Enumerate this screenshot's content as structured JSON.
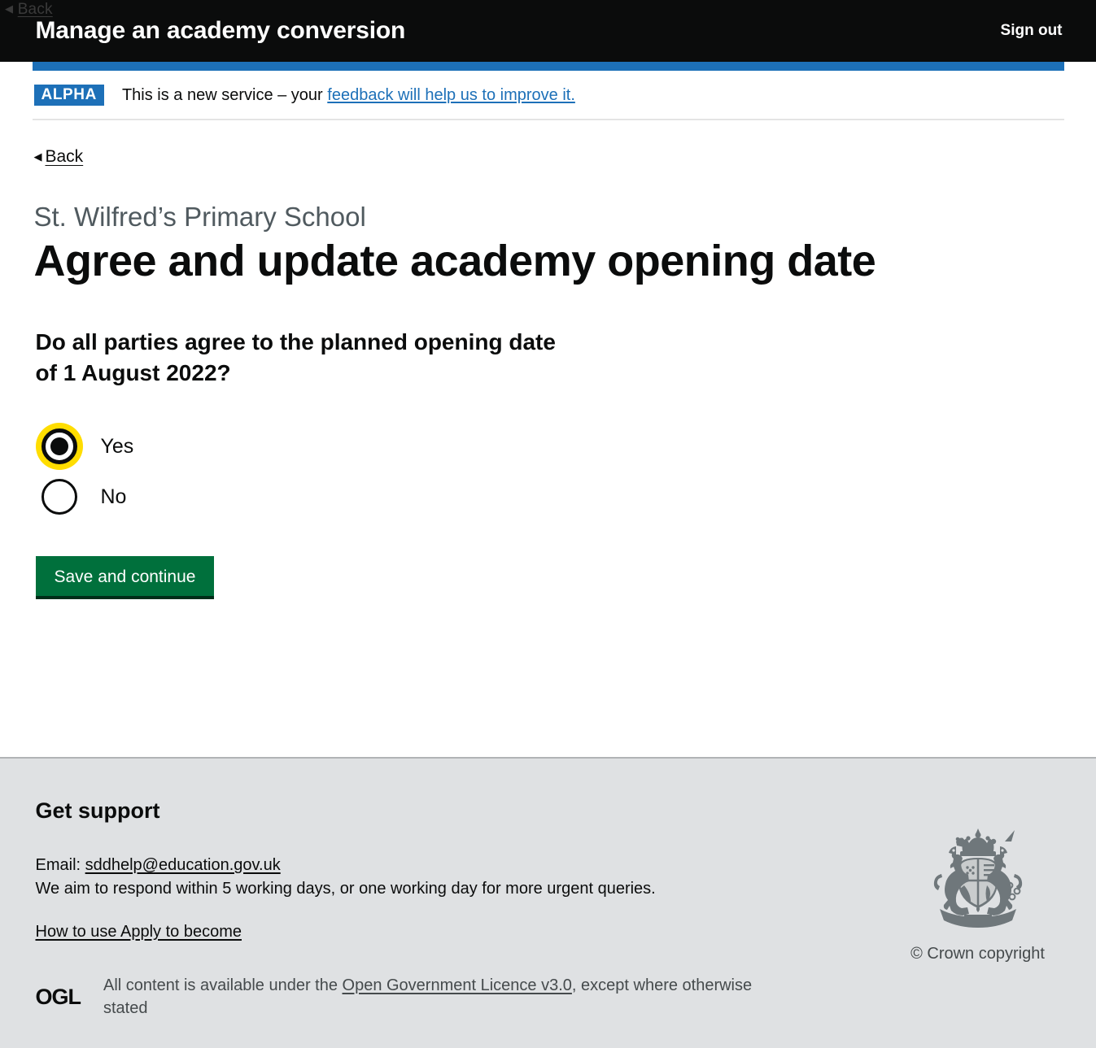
{
  "browser": {
    "back_arrow": "◀",
    "back_label": "Back"
  },
  "header": {
    "service_name": "Manage an academy conversion",
    "sign_out_label": "Sign out"
  },
  "phase_banner": {
    "tag": "ALPHA",
    "text_before": "This is a new service – your ",
    "link_text": "feedback will help us to improve it."
  },
  "back_link": {
    "arrow": "◀",
    "label": "Back"
  },
  "main": {
    "caption": "St. Wilfred’s Primary School",
    "heading": "Agree and update academy opening date",
    "question": "Do all parties agree to the planned opening date of 1 August 2022?",
    "radios": [
      {
        "label": "Yes",
        "selected": true,
        "focused": true
      },
      {
        "label": "No",
        "selected": false,
        "focused": false
      }
    ],
    "submit_label": "Save and continue"
  },
  "footer": {
    "support_heading": "Get support",
    "email_prefix": "Email: ",
    "email_address": "sddhelp@education.gov.uk",
    "response_time": "We aim to respond within 5 working days, or one working day for more urgent queries.",
    "guidance_link": "How to use Apply to become",
    "ogl_logo_text": "OGL",
    "licence_before": "All content is available under the ",
    "licence_link": "Open Government Licence v3.0",
    "licence_after": ", except where otherwise stated",
    "crown_copyright": "© Crown copyright"
  },
  "colors": {
    "header_black": "#0b0c0c",
    "govuk_blue": "#1d70b8",
    "button_green": "#00703c",
    "focus_yellow": "#ffdd00",
    "footer_grey": "#dfe1e3",
    "caption_grey": "#505a5f"
  }
}
